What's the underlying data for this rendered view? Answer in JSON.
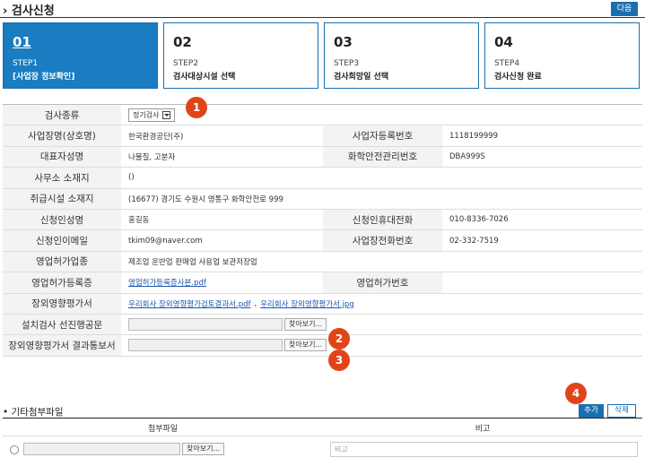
{
  "page": {
    "title": "› 검사신청",
    "next_label": "다음"
  },
  "steps": [
    {
      "num": "01",
      "label": "STEP1",
      "desc": "[사업장 정보확인]",
      "active": true
    },
    {
      "num": "02",
      "label": "STEP2",
      "desc": "검사대상시설 선택",
      "active": false
    },
    {
      "num": "03",
      "label": "STEP3",
      "desc": "검사희망일 선택",
      "active": false
    },
    {
      "num": "04",
      "label": "STEP4",
      "desc": "검사신청 완료",
      "active": false
    }
  ],
  "form": {
    "inspection_type": {
      "label": "검사종류",
      "value": "정기검사"
    },
    "company_name": {
      "label": "사업장명(상호명)",
      "value": "한국환경공단(주)"
    },
    "biz_reg_no": {
      "label": "사업자등록번호",
      "value": "1118199999"
    },
    "representative": {
      "label": "대표자성명",
      "value": "나물질, 고분자"
    },
    "chem_safety_no": {
      "label": "화학안전관리번호",
      "value": "DBA999S"
    },
    "office_address": {
      "label": "사무소 소재지",
      "value": "()"
    },
    "facility_address": {
      "label": "취급시설 소재지",
      "value": "(16677) 경기도 수원시 영통구 화학안전로 999"
    },
    "applicant_name": {
      "label": "신청인성명",
      "value": "홍길동"
    },
    "applicant_mobile": {
      "label": "신청인휴대전화",
      "value": "010-8336-7026"
    },
    "applicant_email": {
      "label": "신청인이메일",
      "value": "tkim09@naver.com"
    },
    "business_phone": {
      "label": "사업장전화번호",
      "value": "02-332-7519"
    },
    "license_type": {
      "label": "영업허가업종",
      "value": "제조업 운반업 판매업 사용업 보관저장업"
    },
    "license_certificate": {
      "label": "영업허가등록증",
      "value": "영업허가등록증사본.pdf"
    },
    "license_no": {
      "label": "영업허가번호",
      "value": ""
    },
    "offsite_assessment": {
      "label": "장외영향평가서",
      "file1": "우리회사 장외영향평가검토결과서.pdf",
      "separator": ",",
      "file2": "우리회사 장외영향평가서.jpg"
    },
    "pre_install_doc": {
      "label": "설치검사 선진행공문",
      "browse": "찾아보기..."
    },
    "offsite_result_doc": {
      "label": "장외영향평가서 결과통보서",
      "browse": "찾아보기..."
    }
  },
  "badges": [
    "1",
    "2",
    "3",
    "4"
  ],
  "attachments": {
    "title": "• 기타첨부파일",
    "add_label": "추가",
    "delete_label": "삭제",
    "col_file": "첨부파일",
    "col_note": "비고",
    "browse": "찾아보기...",
    "note_placeholder": "비고"
  },
  "colors": {
    "primary": "#1a7cc1",
    "badge": "#e0451a",
    "link": "#1a56b0"
  }
}
